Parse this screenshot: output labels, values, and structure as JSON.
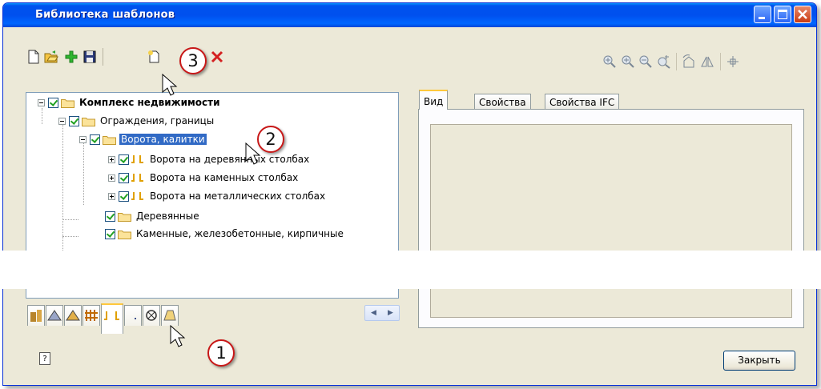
{
  "window": {
    "title": "Библиотека шаблонов"
  },
  "toolbar": {
    "left_icons": [
      "new-file-icon",
      "open-icon",
      "add-icon",
      "save-icon",
      "new-template-icon",
      "delete-icon"
    ],
    "right_icons": [
      "zoom-all-icon",
      "zoom-in-icon",
      "zoom-out-icon",
      "zoom-frame-icon",
      "rotate-icon",
      "mirror-icon",
      "crosshair-icon"
    ]
  },
  "tree": {
    "items": [
      {
        "label": "Комплекс недвижимости"
      },
      {
        "label": "Ограждения, границы"
      },
      {
        "label": "Ворота, калитки"
      },
      {
        "label": "Ворота на деревянных столбах"
      },
      {
        "label": "Ворота на каменных столбах"
      },
      {
        "label": "Ворота на металлических столбах"
      },
      {
        "label": "Деревянные"
      },
      {
        "label": "Каменные, железобетонные, кирпичные"
      }
    ]
  },
  "left_tabs": [
    "building-icon",
    "roof-icon",
    "roof-alt-icon",
    "fence-icon",
    "gate-icon",
    "path-icon",
    "symbol-icon",
    "terrain-icon"
  ],
  "right_tabs": {
    "tab1": "Вид",
    "tab2": "Свойства",
    "tab3": "Свойства IFC"
  },
  "buttons": {
    "close": "Закрыть",
    "help": "?"
  },
  "badges": {
    "b1": "1",
    "b2": "2",
    "b3": "3"
  },
  "colors": {
    "title_bar": "#0054e3",
    "selection": "#316ac5",
    "badge_border": "#c81818"
  }
}
